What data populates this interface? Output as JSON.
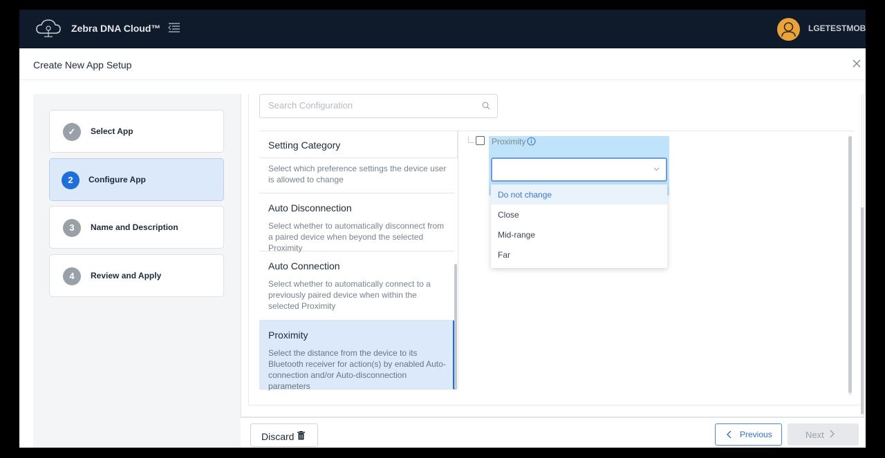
{
  "header": {
    "app_name": "Zebra DNA Cloud™",
    "user_name": "LGETESTMOBI"
  },
  "modal": {
    "title": "Create New App Setup"
  },
  "steps": [
    {
      "number": "✓",
      "label": "Select App",
      "state": "done"
    },
    {
      "number": "2",
      "label": "Configure App",
      "state": "active"
    },
    {
      "number": "3",
      "label": "Name and Description",
      "state": "pending"
    },
    {
      "number": "4",
      "label": "Review and Apply",
      "state": "pending"
    }
  ],
  "search": {
    "placeholder": "Search Configuration",
    "value": ""
  },
  "categories": {
    "heading": "Setting Category",
    "intro": "Select which preference settings the device user is allowed to change",
    "items": [
      {
        "title": "Auto Disconnection",
        "description": "Select whether to automatically disconnect from a paired device when beyond the selected Proximity"
      },
      {
        "title": "Auto Connection",
        "description": "Select whether to automatically connect to a previously paired device when within the selected Proximity"
      },
      {
        "title": "Proximity",
        "description": "Select the distance from the device to its Bluetooth receiver for action(s) by enabled Auto-connection and/or Auto-disconnection parameters",
        "selected": true
      }
    ]
  },
  "config": {
    "label": "Proximity",
    "select_value": "",
    "options": [
      "Do not change",
      "Close",
      "Mid-range",
      "Far"
    ],
    "highlighted_option": "Do not change"
  },
  "footer": {
    "discard_label": "Discard",
    "previous_label": "Previous",
    "next_label": "Next"
  },
  "colors": {
    "topbar": "#0f1a2b",
    "accent": "#1e6fd9",
    "selected_bg": "#dce9fb",
    "config_highlight": "#bfe3f8",
    "avatar": "#e8a33b"
  }
}
